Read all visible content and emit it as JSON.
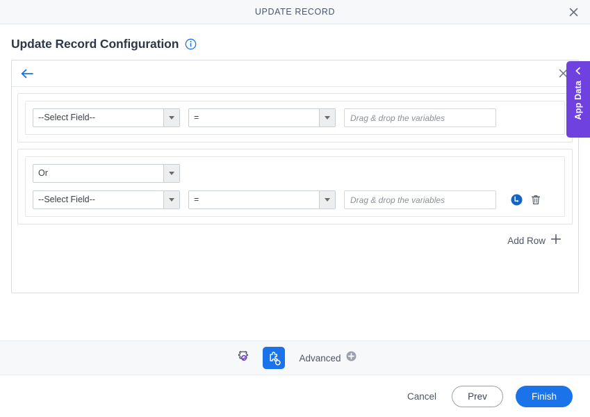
{
  "window": {
    "title": "UPDATE RECORD",
    "close_icon": "close-icon"
  },
  "page": {
    "heading": "Update Record Configuration",
    "info_icon": "info-circle-icon"
  },
  "builder": {
    "back_icon": "arrow-left-icon",
    "close_icon": "close-icon",
    "groups": [
      {
        "logic": null,
        "rows": [
          {
            "field": "--Select Field--",
            "operator": "=",
            "value": "",
            "value_placeholder": "Drag & drop the variables",
            "actions": []
          }
        ]
      },
      {
        "logic": "Or",
        "rows": [
          {
            "field": "--Select Field--",
            "operator": "=",
            "value": "",
            "value_placeholder": "Drag & drop the variables",
            "actions": [
              "add-sub-condition-icon",
              "delete-row-icon"
            ]
          }
        ]
      }
    ],
    "add_row_label": "Add Row",
    "add_row_icon": "plus-icon"
  },
  "advanced_bar": {
    "gear_icon": "gear-icon",
    "puzzle_icon": "puzzle-piece-icon",
    "label": "Advanced",
    "expand_icon": "plus-circle-icon"
  },
  "footer": {
    "cancel_label": "Cancel",
    "prev_label": "Prev",
    "finish_label": "Finish"
  },
  "app_data_tab": {
    "label": "App Data",
    "chevron_icon": "chevron-left-icon"
  },
  "colors": {
    "accent_blue": "#1a73e8",
    "purple": "#6f42e0",
    "gear_purple": "#7c3aed",
    "titlebar_bg": "#f7f8fa",
    "border": "#d8dce2"
  }
}
